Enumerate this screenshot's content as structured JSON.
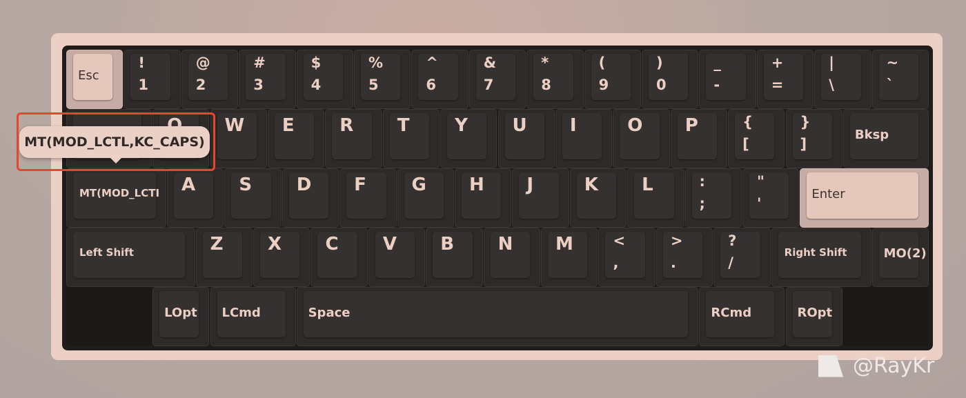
{
  "keyboard": {
    "rows": [
      [
        {
          "label": "Esc",
          "light": true
        },
        {
          "top": "!",
          "bottom": "1"
        },
        {
          "top": "@",
          "bottom": "2"
        },
        {
          "top": "#",
          "bottom": "3"
        },
        {
          "top": "$",
          "bottom": "4"
        },
        {
          "top": "%",
          "bottom": "5"
        },
        {
          "top": "^",
          "bottom": "6"
        },
        {
          "top": "&",
          "bottom": "7"
        },
        {
          "top": "*",
          "bottom": "8"
        },
        {
          "top": "(",
          "bottom": "9"
        },
        {
          "top": ")",
          "bottom": "0"
        },
        {
          "top": "_",
          "bottom": "-"
        },
        {
          "top": "+",
          "bottom": "="
        },
        {
          "top": "|",
          "bottom": "\\"
        },
        {
          "top": "~",
          "bottom": "`"
        }
      ],
      [
        {
          "label": ""
        },
        {
          "letter": "Q"
        },
        {
          "letter": "W"
        },
        {
          "letter": "E"
        },
        {
          "letter": "R"
        },
        {
          "letter": "T"
        },
        {
          "letter": "Y"
        },
        {
          "letter": "U"
        },
        {
          "letter": "I"
        },
        {
          "letter": "O"
        },
        {
          "letter": "P"
        },
        {
          "top": "{",
          "bottom": "["
        },
        {
          "top": "}",
          "bottom": "]"
        },
        {
          "label": "Bksp"
        }
      ],
      [
        {
          "label": "MT(MOD_LCTI"
        },
        {
          "letter": "A"
        },
        {
          "letter": "S"
        },
        {
          "letter": "D"
        },
        {
          "letter": "F"
        },
        {
          "letter": "G"
        },
        {
          "letter": "H"
        },
        {
          "letter": "J"
        },
        {
          "letter": "K"
        },
        {
          "letter": "L"
        },
        {
          "top": ":",
          "bottom": ";"
        },
        {
          "top": "\"",
          "bottom": "'"
        },
        {
          "label": "Enter",
          "light": true
        }
      ],
      [
        {
          "label": "Left Shift"
        },
        {
          "letter": "Z"
        },
        {
          "letter": "X"
        },
        {
          "letter": "C"
        },
        {
          "letter": "V"
        },
        {
          "letter": "B"
        },
        {
          "letter": "N"
        },
        {
          "letter": "M"
        },
        {
          "top": "<",
          "bottom": ","
        },
        {
          "top": ">",
          "bottom": "."
        },
        {
          "top": "?",
          "bottom": "/"
        },
        {
          "label": "Right Shift"
        },
        {
          "label": "MO(2)"
        }
      ],
      [
        {
          "blank": true
        },
        {
          "label": "LOpt"
        },
        {
          "label": "LCmd"
        },
        {
          "label": "Space"
        },
        {
          "label": "RCmd"
        },
        {
          "label": "ROpt"
        },
        {
          "blank": true
        }
      ]
    ]
  },
  "tooltip": {
    "text": "MT(MOD_LCTL,KC_CAPS)"
  },
  "watermark": {
    "text": "@RayKr"
  },
  "colors": {
    "legend": "#ebcfc3",
    "highlight": "#e2472f",
    "accent_key": "#e6c7bc",
    "case": "#ecd0c5"
  }
}
